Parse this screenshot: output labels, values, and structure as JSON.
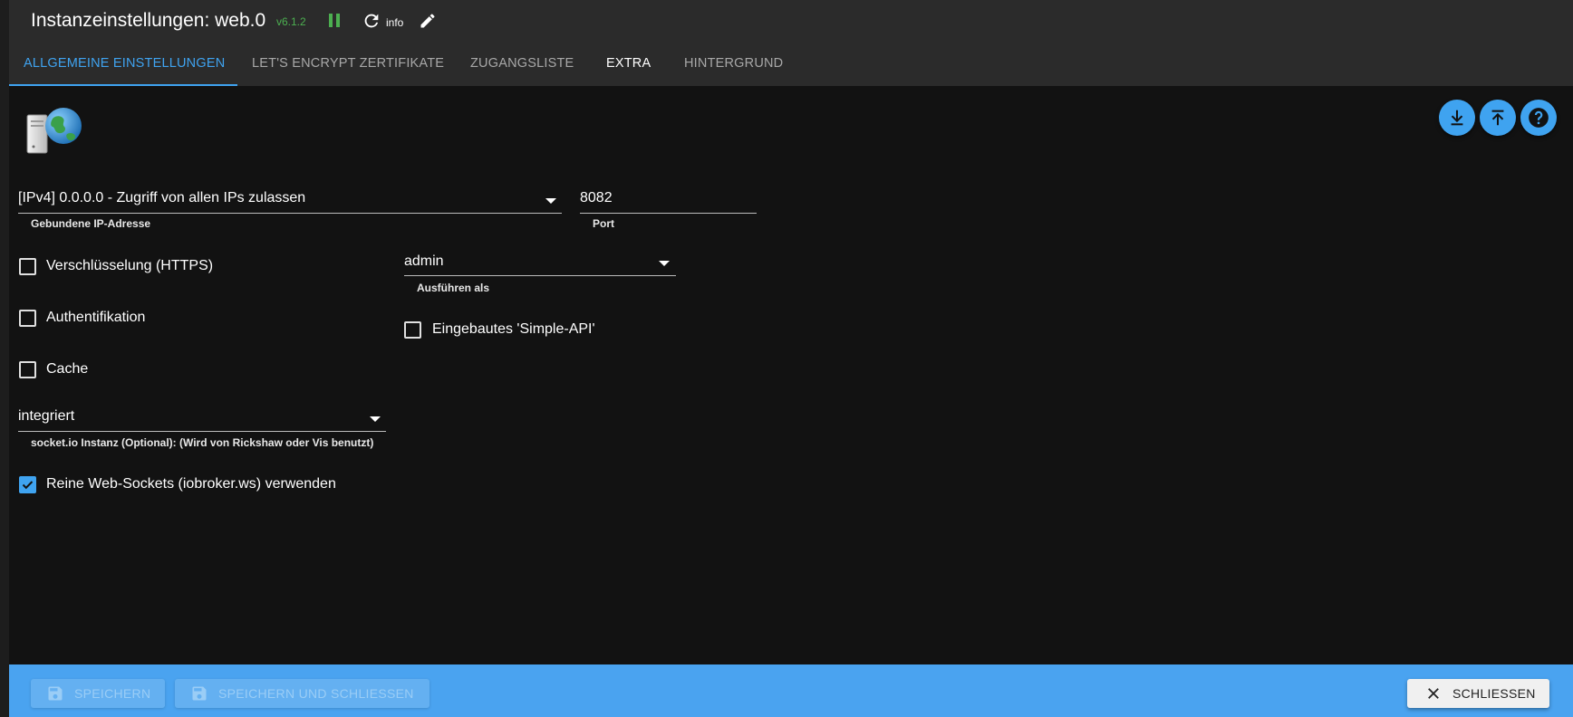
{
  "header": {
    "title": "Instanzeinstellungen: web.0",
    "version": "v6.1.2",
    "info_label": "info"
  },
  "tabs": [
    {
      "label": "Allgemeine Einstellungen",
      "active": true
    },
    {
      "label": "Let's Encrypt Zertifikate",
      "active": false
    },
    {
      "label": "Zugangsliste",
      "active": false
    },
    {
      "label": "Extra",
      "active": false
    },
    {
      "label": "Hintergrund",
      "active": false
    }
  ],
  "toolbar_icons": [
    "download-icon",
    "upload-icon",
    "help-icon"
  ],
  "form": {
    "bind_ip": {
      "value": "[IPv4] 0.0.0.0 - Zugriff von allen IPs zulassen",
      "help": "Gebundene IP-Adresse"
    },
    "port": {
      "value": "8082",
      "help": "Port"
    },
    "https": {
      "label": "Verschlüsselung (HTTPS)",
      "checked": false
    },
    "run_as": {
      "value": "admin",
      "help": "Ausführen als"
    },
    "auth": {
      "label": "Authentifikation",
      "checked": false
    },
    "simple_api": {
      "label": "Eingebautes 'Simple-API'",
      "checked": false
    },
    "cache": {
      "label": "Cache",
      "checked": false
    },
    "socketio": {
      "value": "integriert",
      "help": "socket.io Instanz (Optional): (Wird von Rickshaw oder Vis benutzt)"
    },
    "pure_ws": {
      "label": "Reine Web-Sockets (iobroker.ws) verwenden",
      "checked": true
    }
  },
  "footer": {
    "save": "SPEICHERN",
    "save_close": "SPEICHERN UND SCHLIESSEN",
    "close": "SCHLIESSEN"
  },
  "colors": {
    "accent": "#3fa3f0",
    "background": "#121212",
    "header": "#2b2b2b",
    "footer": "#4aa3f0",
    "version": "#4caf50"
  }
}
